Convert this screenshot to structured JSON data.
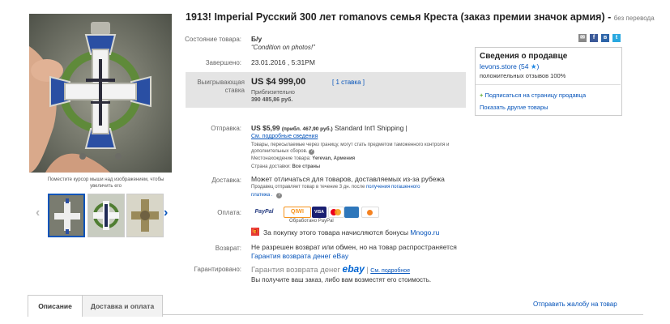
{
  "title": {
    "main": "1913! Imperial Русский 300 лет romanovs семья Креста (заказ премии значок армия) -",
    "translate_link": "без перевода"
  },
  "condition": {
    "label": "Состояние товара:",
    "value": "Б/у",
    "note": "Condition on photos!"
  },
  "ended": {
    "label": "Завершено:",
    "value": "23.01.2016 , 5:31PM"
  },
  "bid": {
    "label_line1": "Выигрывающая",
    "label_line2": "ставка",
    "price": "US $4 999,00",
    "approx_label": "Приблизительно",
    "approx_value": "390 485,86 руб.",
    "count": "[ 1 ставка ]"
  },
  "photo_hint": "Поместите курсор мыши над изображением, чтобы увеличить его",
  "shipping": {
    "label": "Отправка:",
    "price": "US $5,99",
    "approx": "(прибл. 467,90 руб.)",
    "service": "Standard Int'l Shipping |",
    "details_link": "См. подробные сведения",
    "customs_note": "Товары, пересылаемые через границу, могут стать предметом таможенного контроля и дополнительных сборов.",
    "location_label": "Местонахождение товара:",
    "location_value": "Yerevan, Армения",
    "country_label": "Страна доставки:",
    "country_value": "Все страны"
  },
  "delivery": {
    "label": "Доставка:",
    "line1": "Может отличаться для товаров, доставляемых из-за рубежа",
    "line2": "Продавец отправляет товар в течение 3 дн. после",
    "line2_link": "получения погашенного",
    "line3_link": "платежа ."
  },
  "payment": {
    "label": "Оплата:",
    "paypal": "PayPal",
    "qiwi": "QIWI",
    "visa": "VISA",
    "processed": "Обработано PayPal",
    "bonus_text": "За покупку этого товара начисляются бонусы",
    "bonus_link": "Mnogo.ru"
  },
  "returns": {
    "label": "Возврат:",
    "line1": "Не разрешен возврат или обмен, но на товар распространяется",
    "line2_link": "Гарантия возврата денег eBay"
  },
  "guarantee": {
    "label": "Гарантировано:",
    "text": "Гарантия возврата денег",
    "ebay": "ebay",
    "sep": "|",
    "details_link": "См. подробное",
    "line2": "Вы получите ваш заказ, либо вам возместят его стоимость."
  },
  "seller": {
    "heading": "Сведения о продавце",
    "name": "levons.store",
    "score": "(54",
    "positive": "положительных отзывов 100%",
    "subscribe": "Подписаться на страницу продавца",
    "other_items": "Показать другие товары"
  },
  "tabs": [
    {
      "label": "Описание"
    },
    {
      "label": "Доставка и оплата"
    }
  ],
  "report_link": "Отправить жалобу на товар",
  "colors": {
    "link": "#0654ba",
    "bid_box": "#e4e4e4",
    "accent": "#1e88e5"
  }
}
